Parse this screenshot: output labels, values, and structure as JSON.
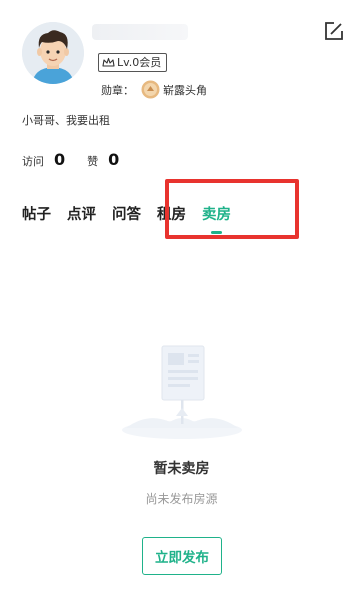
{
  "profile": {
    "level_badge": "Lv.0会员",
    "medal_label": "勋章：",
    "medal_name": "崭露头角",
    "bio": "小哥哥、我要出租"
  },
  "stats": {
    "visits_label": "访问",
    "visits_value": "0",
    "likes_label": "赞",
    "likes_value": "0"
  },
  "tabs": [
    {
      "label": "帖子"
    },
    {
      "label": "点评"
    },
    {
      "label": "问答"
    },
    {
      "label": "租房"
    },
    {
      "label": "卖房",
      "active": true
    }
  ],
  "empty_state": {
    "title": "暂未卖房",
    "subtitle": "尚未发布房源",
    "button_label": "立即发布"
  },
  "colors": {
    "accent": "#1fb28a",
    "highlight": "#e8332e"
  },
  "icons": [
    "edit-icon",
    "avatar",
    "crown-icon",
    "medal-icon",
    "empty-listing-illustration"
  ]
}
